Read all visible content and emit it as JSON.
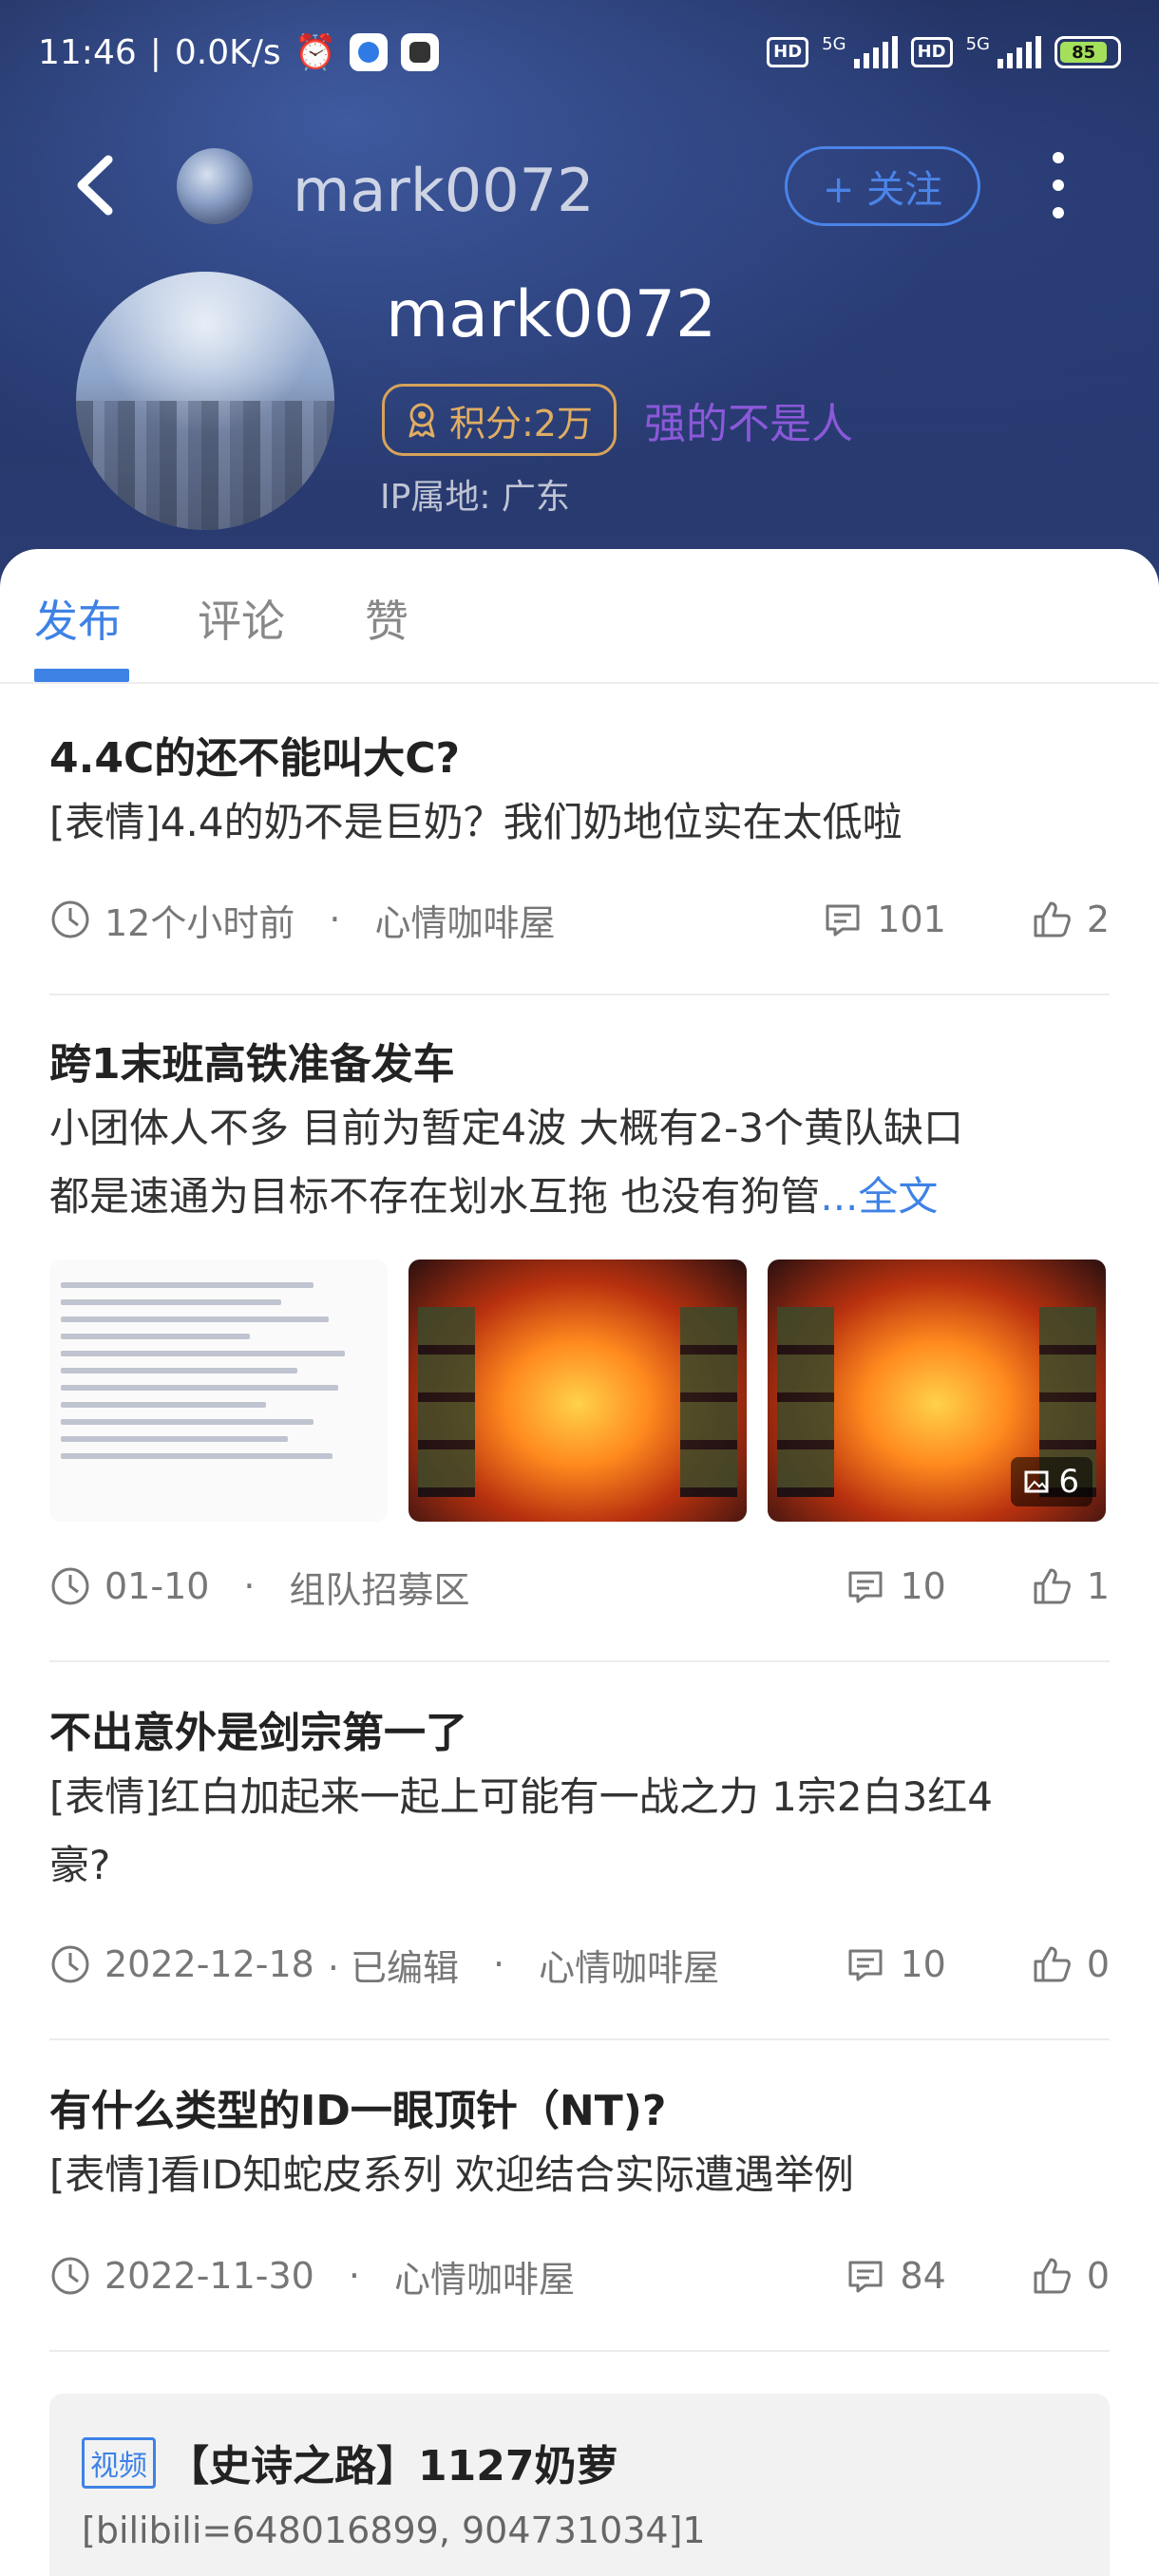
{
  "status_bar": {
    "time": "11:46",
    "speed": "0.0K/s",
    "hd1": "HD",
    "net1": "5G",
    "hd2": "HD",
    "net2": "5G",
    "battery": "85"
  },
  "nav": {
    "username": "mark0072",
    "follow_label": "+ 关注"
  },
  "profile": {
    "name": "mark0072",
    "score_label": "积分:2万",
    "title": "强的不是人",
    "ip": "IP属地: 广东"
  },
  "tabs": [
    {
      "label": "发布"
    },
    {
      "label": "评论"
    },
    {
      "label": "赞"
    }
  ],
  "posts": [
    {
      "title": "4.4C的还不能叫大C?",
      "body": "[表情]4.4的奶不是巨奶？我们奶地位实在太低啦",
      "time": "12个小时前",
      "dot": "·",
      "board": "心情咖啡屋",
      "comments": "101",
      "likes": "2"
    },
    {
      "title": "跨1末班高铁准备发车",
      "body1": "小团体人不多 目前为暂定4波 大概有2-3个黄队缺口",
      "body2": "都是速通为目标不存在划水互拖 也没有狗管",
      "more": "...全文",
      "image_count": "6",
      "time": "01-10",
      "dot": "·",
      "board": "组队招募区",
      "comments": "10",
      "likes": "1"
    },
    {
      "title": "不出意外是剑宗第一了",
      "body1": " [表情]红白加起来一起上可能有一战之力 1宗2白3红4",
      "body2": "豪?",
      "time": "2022-12-18",
      "edited": "· 已编辑",
      "dot": "·",
      "board": "心情咖啡屋",
      "comments": "10",
      "likes": "0"
    },
    {
      "title": "有什么类型的ID一眼顶针（NT)?",
      "body": "[表情]看ID知蛇皮系列 欢迎结合实际遭遇举例",
      "time": "2022-11-30",
      "dot": "·",
      "board": "心情咖啡屋",
      "comments": "84",
      "likes": "0"
    }
  ],
  "video_card": {
    "tag": "视频",
    "title": "【史诗之路】1127奶萝",
    "body": "[bilibili=648016899, 904731034]1"
  },
  "colors": {
    "accent": "#3e82e6",
    "badge_gold": "#d7a35a",
    "title_purple": "#8b59d9"
  }
}
